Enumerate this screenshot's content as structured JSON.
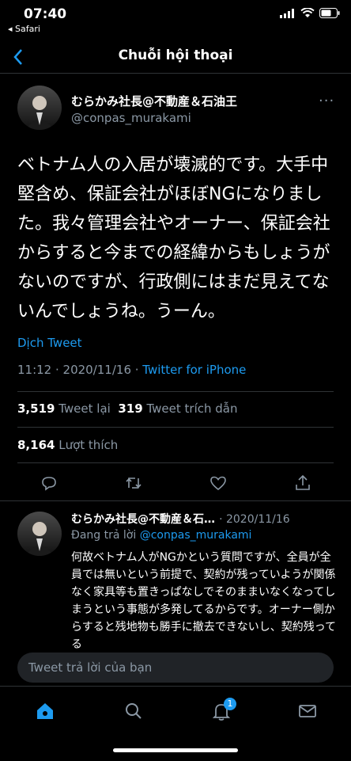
{
  "status": {
    "time": "07:40",
    "back_app": "◂ Safari"
  },
  "nav": {
    "title": "Chuỗi hội thoại"
  },
  "tweet": {
    "name": "むらかみ社長@不動産＆石油王",
    "handle": "@conpas_murakami",
    "text": "ベトナム人の入居が壊滅的です。大手中堅含め、保証会社がほぼNGになりました。我々管理会社やオーナー、保証会社からすると今までの経緯からもしょうがないのですが、行政側にはまだ見えてないんでしょうね。うーん。",
    "translate": "Dịch Tweet",
    "time": "11:12 · 2020/11/16 · ",
    "source": "Twitter for iPhone",
    "retweets": "3,519",
    "retweets_label": "Tweet lại",
    "quotes": "319",
    "quotes_label": "Tweet trích dẫn",
    "likes": "8,164",
    "likes_label": "Lượt thích"
  },
  "reply": {
    "name": "むらかみ社長@不動産＆石…",
    "date": "· 2020/11/16",
    "replying_to_label": "Đang trả lời ",
    "replying_to_handle": "@conpas_murakami",
    "text": "何故ベトナム人がNGかという質問ですが、全員が全員では無いという前提で、契約が残っていようが関係なく家具等も置きっぱなしでそのままいなくなってしまうという事態が多発してるからです。オーナー側からすると残地物も勝手に撤去できないし、契約残ってる"
  },
  "composer": {
    "placeholder": "Tweet trả lời của bạn"
  },
  "tabbar": {
    "notifications_badge": "1"
  },
  "colors": {
    "accent": "#1d9bf0",
    "background": "#000000",
    "muted": "#8b98a5"
  }
}
